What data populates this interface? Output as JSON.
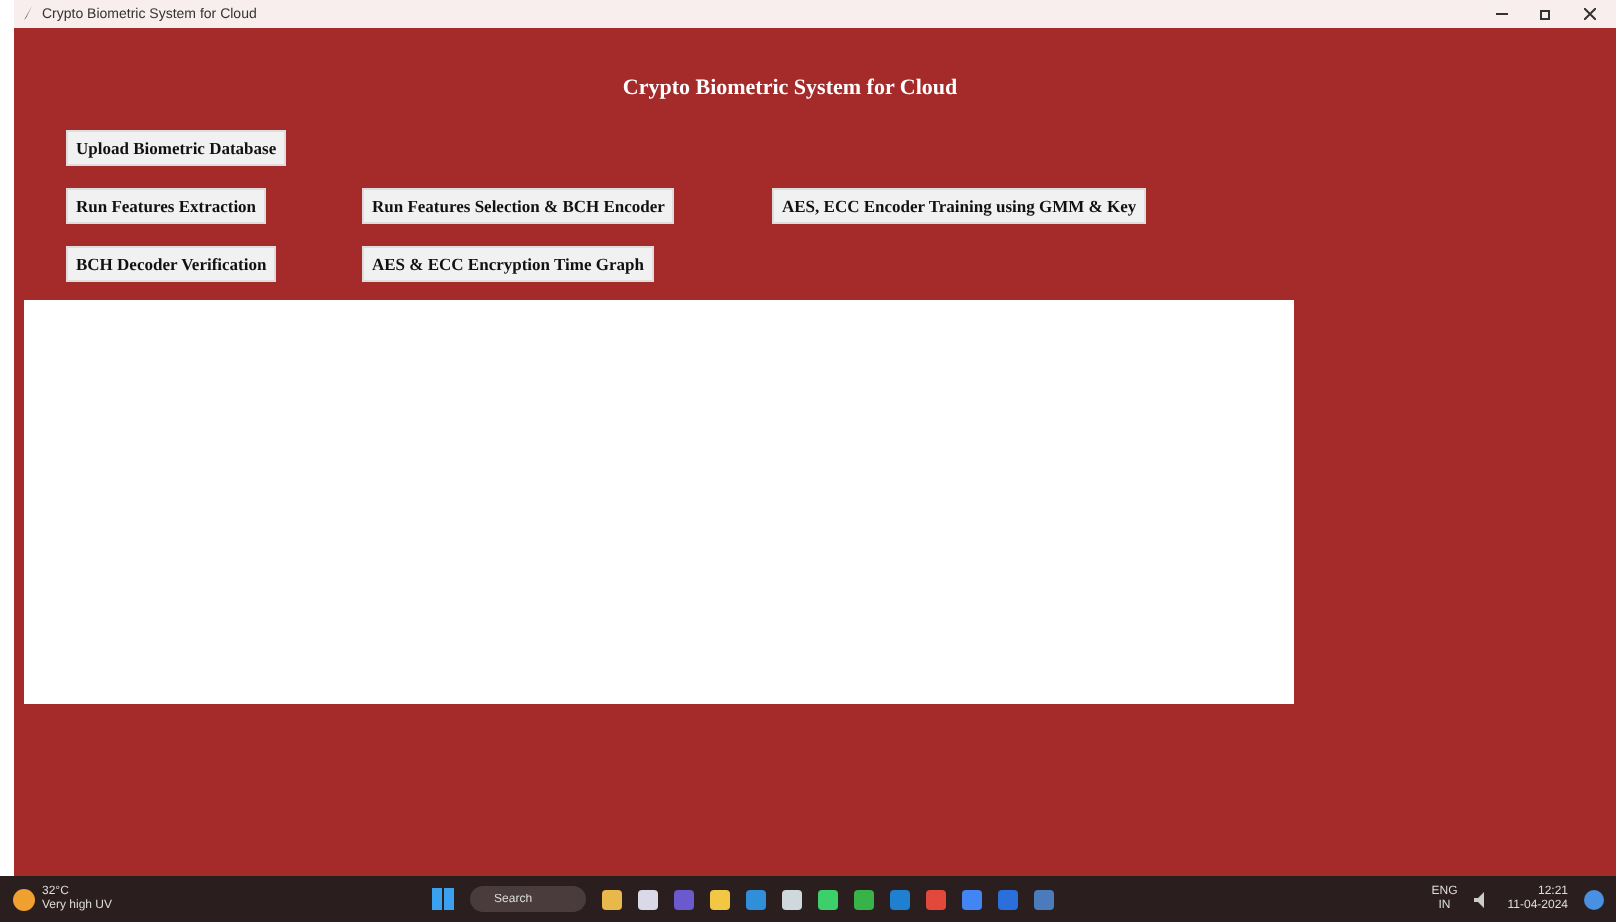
{
  "window": {
    "title": "Crypto Biometric System for Cloud"
  },
  "heading": "Crypto Biometric System for Cloud",
  "button_rows": [
    [
      "Upload Biometric Database"
    ],
    [
      "Run Features Extraction",
      "Run Features Selection & BCH Encoder",
      "AES, ECC Encoder Training using GMM & Key"
    ],
    [
      "BCH Decoder Verification",
      "AES & ECC Encryption Time Graph"
    ]
  ],
  "taskbar": {
    "weather": {
      "temp": "32°C",
      "condition": "Very high UV"
    },
    "search": {
      "placeholder": "Search"
    },
    "apps": [
      {
        "color": "#e8b84a"
      },
      {
        "color": "#d9d9e8"
      },
      {
        "color": "#6a5acd"
      },
      {
        "color": "#f2c744"
      },
      {
        "color": "#2f8fd8"
      },
      {
        "color": "#cfd8dc"
      },
      {
        "color": "#3ccf6a"
      },
      {
        "color": "#37b34a"
      },
      {
        "color": "#1f7fd1"
      },
      {
        "color": "#e2493b"
      },
      {
        "color": "#4285f4"
      },
      {
        "color": "#2a6fdb"
      },
      {
        "color": "#4b7bbd"
      }
    ],
    "language": "ENG",
    "region": "IN",
    "time": "12:21",
    "date": "11-04-2024"
  }
}
